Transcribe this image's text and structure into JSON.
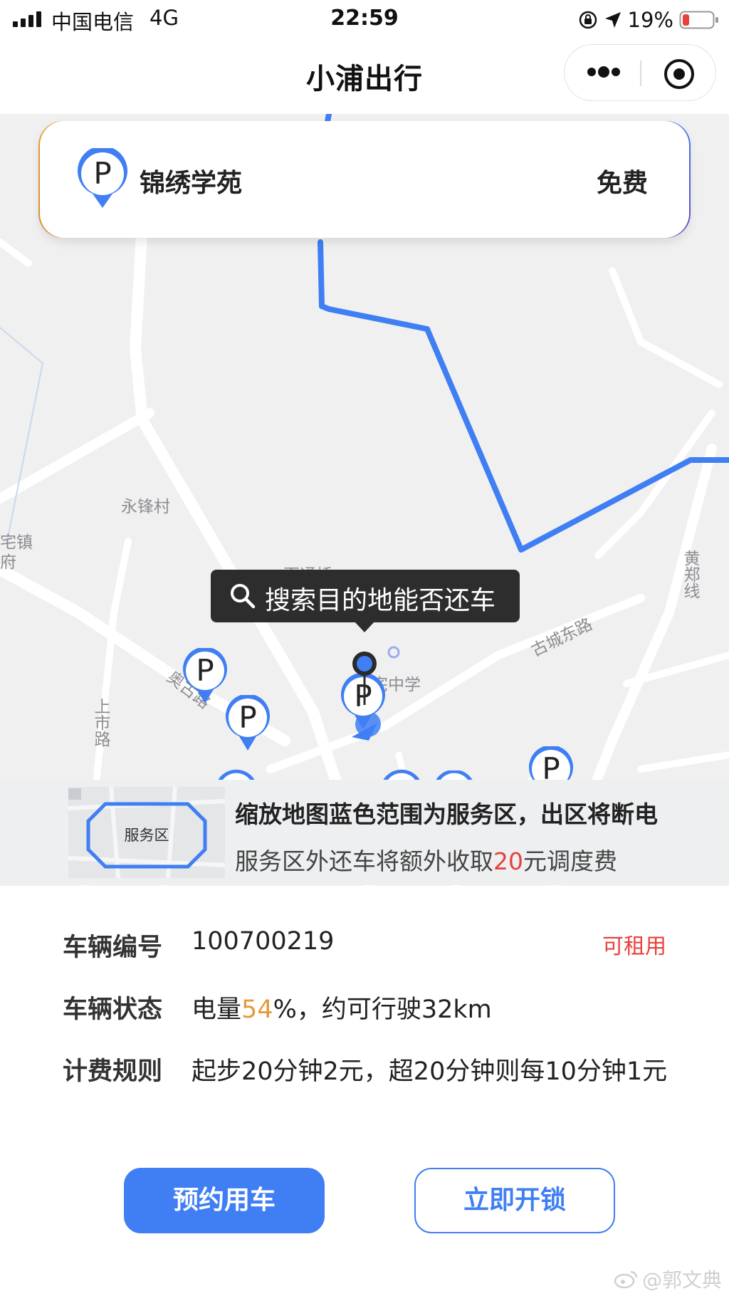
{
  "status_bar": {
    "carrier": "中国电信",
    "network": "4G",
    "time": "22:59",
    "battery_pct": "19%",
    "icons": [
      "signal-bars-icon",
      "rotation-lock-icon",
      "location-arrow-icon",
      "battery-low-icon"
    ]
  },
  "nav": {
    "title": "小浦出行",
    "more_icon": "more-dots-icon",
    "close_icon": "miniprogram-close-icon"
  },
  "parking_card": {
    "name": "锦绣学苑",
    "fee": "免费",
    "icon": "parking-pin-icon"
  },
  "map": {
    "labels": [
      "永锋村",
      "宅镇",
      "府",
      "百通桥",
      "宅中学",
      "古城东路",
      "黄郑线",
      "上市路",
      "奥古路"
    ],
    "tooltip": "搜索目的地能否还车",
    "pin_letter": "P",
    "route_color": "#3f7ef3"
  },
  "service_banner": {
    "zone_label": "服务区",
    "line1": "缩放地图蓝色范围为服务区，出区将断电",
    "line2_prefix": "服务区外还车将额外收取",
    "line2_amount": "20",
    "line2_suffix": "元调度费"
  },
  "vehicle": {
    "id_label": "车辆编号",
    "id_value": "100700219",
    "availability": "可租用",
    "status_label": "车辆状态",
    "status_prefix": "电量",
    "battery_value": "54",
    "status_suffix": "%，约可行驶32km",
    "rules_label": "计费规则",
    "rules_value": "起步20分钟2元，超20分钟则每10分钟1元"
  },
  "actions": {
    "reserve": "预约用车",
    "unlock": "立即开锁"
  },
  "watermark": "@郭文典",
  "colors": {
    "accent": "#3f7ef3",
    "alert": "#e8413b",
    "battery": "#e59a3c"
  }
}
